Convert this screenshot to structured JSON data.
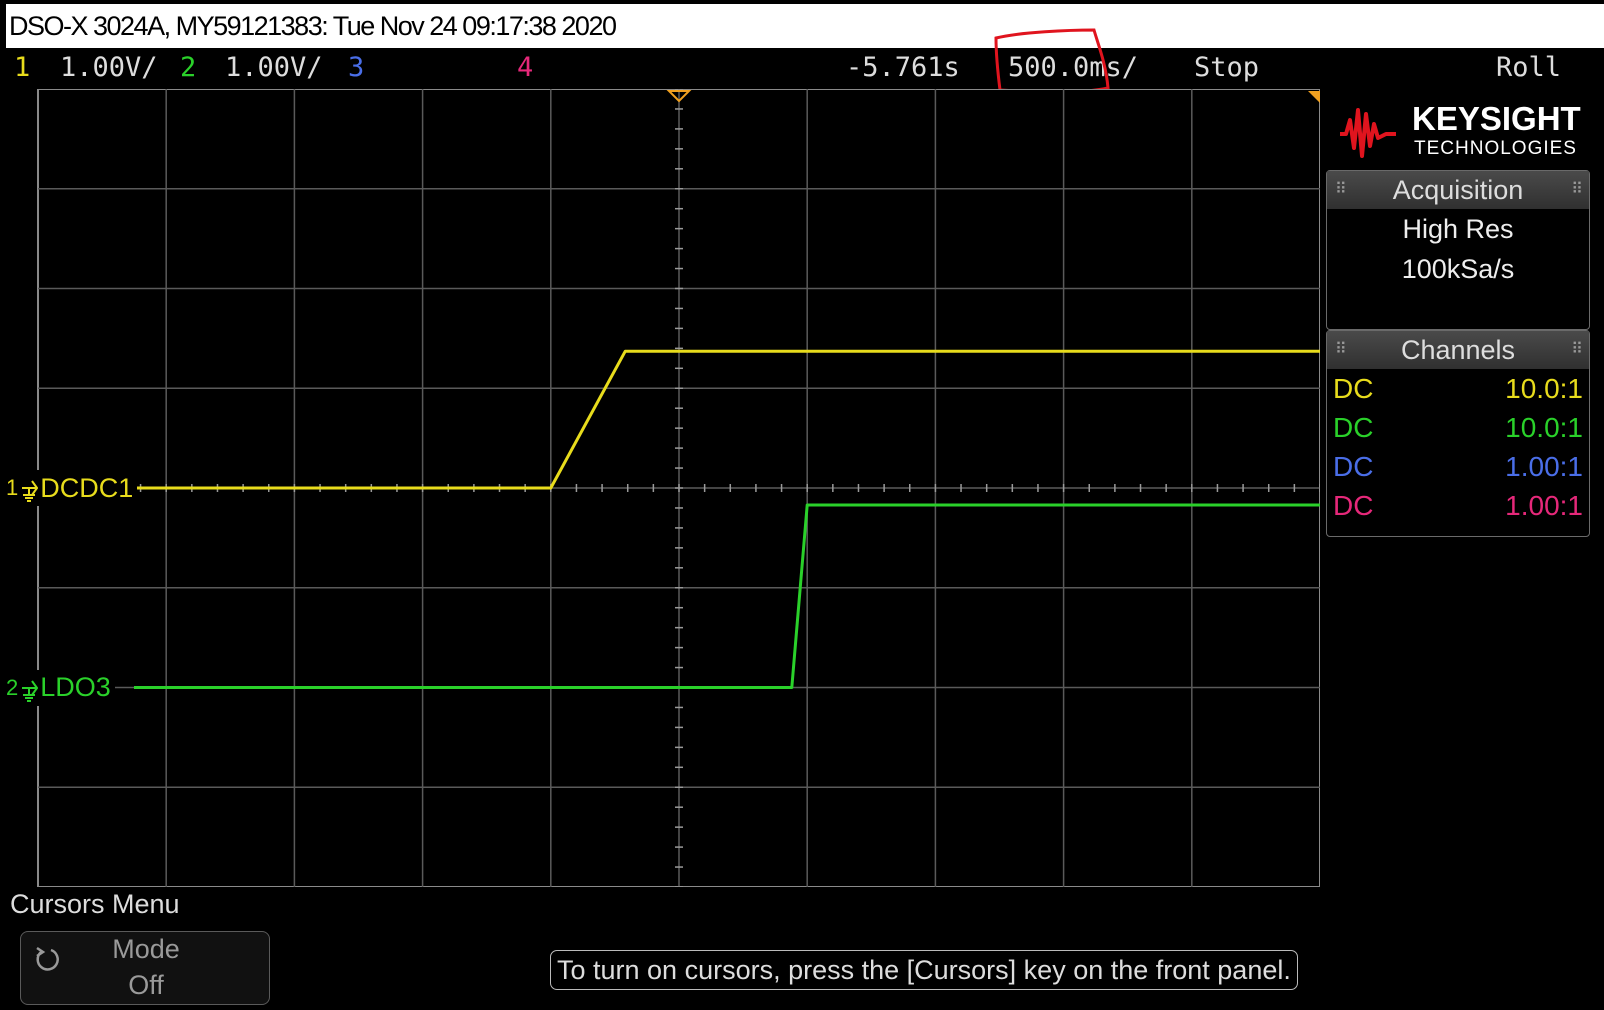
{
  "title": "DSO-X 3024A, MY59121383: Tue Nov 24 09:17:38 2020",
  "header": {
    "ch1_num": "1",
    "ch1_scale": "1.00V/",
    "ch2_num": "2",
    "ch2_scale": "1.00V/",
    "ch3_num": "3",
    "ch4_num": "4",
    "time_delay": "-5.761s",
    "time_scale": "500.0ms/",
    "run_state": "Stop",
    "mode": "Roll"
  },
  "traces": [
    {
      "name": "DCDC1",
      "color": "#e8dc1c",
      "points": [
        [
          -5,
          0
        ],
        [
          -1,
          0
        ],
        [
          -0.42,
          1.37
        ],
        [
          5,
          1.37
        ]
      ]
    },
    {
      "name": "LDO3",
      "color": "#2ad12a",
      "points": [
        [
          -5,
          -2
        ],
        [
          0.88,
          -2
        ],
        [
          1.0,
          -0.17
        ],
        [
          5,
          -0.17
        ]
      ]
    }
  ],
  "channel_markers": [
    {
      "num": "1",
      "label": "DCDC1",
      "color": "#e8dc1c",
      "level": 0
    },
    {
      "num": "2",
      "label": "LDO3",
      "color": "#2ad12a",
      "level": -2
    }
  ],
  "logo": {
    "name": "KEYSIGHT",
    "sub": "TECHNOLOGIES"
  },
  "acquisition": {
    "title": "Acquisition",
    "mode": "High Res",
    "rate": "100kSa/s"
  },
  "channels": {
    "title": "Channels",
    "rows": [
      {
        "coupling": "DC",
        "probe": "10.0:1",
        "color": "#e8dc1c"
      },
      {
        "coupling": "DC",
        "probe": "10.0:1",
        "color": "#2ad12a"
      },
      {
        "coupling": "DC",
        "probe": "1.00:1",
        "color": "#4a6ee8"
      },
      {
        "coupling": "DC",
        "probe": "1.00:1",
        "color": "#e6287a"
      }
    ]
  },
  "menu": {
    "title": "Cursors Menu",
    "mode_label": "Mode",
    "mode_value": "Off"
  },
  "message": "To turn on cursors, press the [Cursors] key on the front panel.",
  "colors": {
    "ch1": "#e8dc1c",
    "ch2": "#2ad12a",
    "ch3": "#4a6ee8",
    "ch4": "#e6287a",
    "annotation": "#e0141e",
    "grid": "#5a5a5a"
  }
}
